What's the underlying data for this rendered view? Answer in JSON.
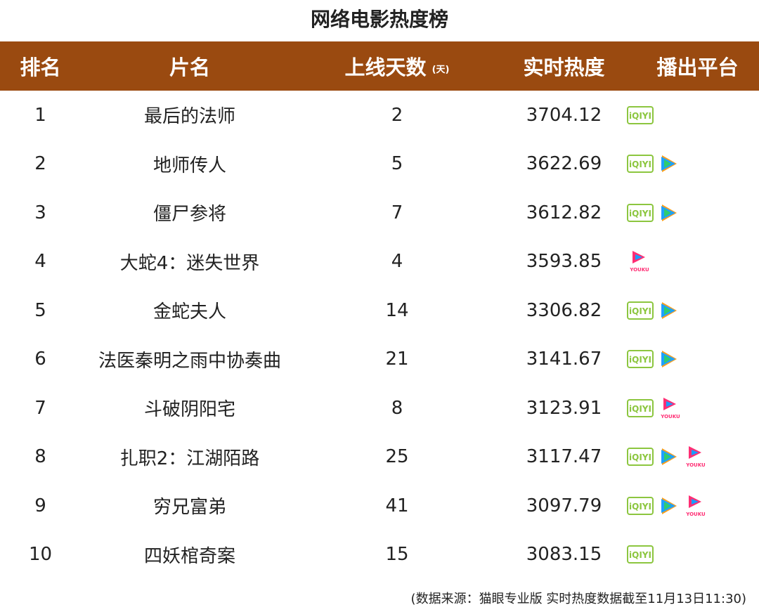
{
  "title": "网络电影热度榜",
  "header": {
    "rank": "排名",
    "name": "片名",
    "days": "上线天数",
    "days_unit": "(天)",
    "heat": "实时热度",
    "platform": "播出平台"
  },
  "rows": [
    {
      "rank": "1",
      "name": "最后的法师",
      "days": "2",
      "heat": "3704.12",
      "platforms": [
        "iqiyi"
      ]
    },
    {
      "rank": "2",
      "name": "地师传人",
      "days": "5",
      "heat": "3622.69",
      "platforms": [
        "iqiyi",
        "tencent"
      ]
    },
    {
      "rank": "3",
      "name": "僵尸参将",
      "days": "7",
      "heat": "3612.82",
      "platforms": [
        "iqiyi",
        "tencent"
      ]
    },
    {
      "rank": "4",
      "name": "大蛇4：迷失世界",
      "days": "4",
      "heat": "3593.85",
      "platforms": [
        "youku"
      ]
    },
    {
      "rank": "5",
      "name": "金蛇夫人",
      "days": "14",
      "heat": "3306.82",
      "platforms": [
        "iqiyi",
        "tencent"
      ]
    },
    {
      "rank": "6",
      "name": "法医秦明之雨中协奏曲",
      "days": "21",
      "heat": "3141.67",
      "platforms": [
        "iqiyi",
        "tencent"
      ]
    },
    {
      "rank": "7",
      "name": "斗破阴阳宅",
      "days": "8",
      "heat": "3123.91",
      "platforms": [
        "iqiyi",
        "youku"
      ]
    },
    {
      "rank": "8",
      "name": "扎职2：江湖陌路",
      "days": "25",
      "heat": "3117.47",
      "platforms": [
        "iqiyi",
        "tencent",
        "youku"
      ]
    },
    {
      "rank": "9",
      "name": "穷兄富弟",
      "days": "41",
      "heat": "3097.79",
      "platforms": [
        "iqiyi",
        "tencent",
        "youku"
      ]
    },
    {
      "rank": "10",
      "name": "四妖棺奇案",
      "days": "15",
      "heat": "3083.15",
      "platforms": [
        "iqiyi"
      ]
    }
  ],
  "logo_text": {
    "iqiyi": "iQIYI",
    "youku": "YOUKU"
  },
  "colors": {
    "header_bg": "#9a4a10",
    "iqiyi": "#8cc63f",
    "tencent_blue": "#1ea0ff",
    "tencent_green": "#2ecc71",
    "tencent_orange": "#ff9f1a",
    "youku_pink": "#ff2e74",
    "youku_blue": "#1a9cff"
  },
  "footer": "(数据来源：猫眼专业版 实时热度数据截至11月13日11:30)"
}
